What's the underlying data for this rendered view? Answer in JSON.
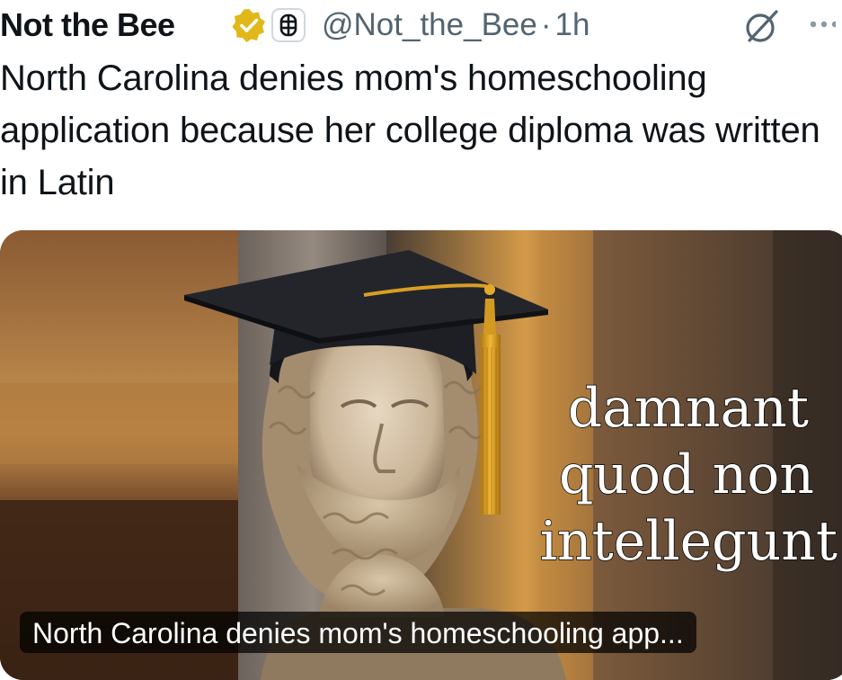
{
  "post": {
    "author_name": "Not the Bee",
    "handle": "@Not_the_Bee",
    "separator": "·",
    "time": "1h",
    "text": "North Carolina denies mom's homeschooling application because her college diploma was written in Latin",
    "icons": {
      "verified": "verified-badge-icon",
      "affiliate": "bee-affiliate-icon",
      "grok": "grok-icon",
      "more": "more-options-icon"
    },
    "colors": {
      "verified_gold": "#e2b719",
      "handle_gray": "#536471",
      "text": "#0f1419"
    }
  },
  "media": {
    "overlay_lines": [
      "damnant",
      "quod non",
      "intellegunt"
    ],
    "link_caption": "North Carolina denies mom's homeschooling app..."
  }
}
